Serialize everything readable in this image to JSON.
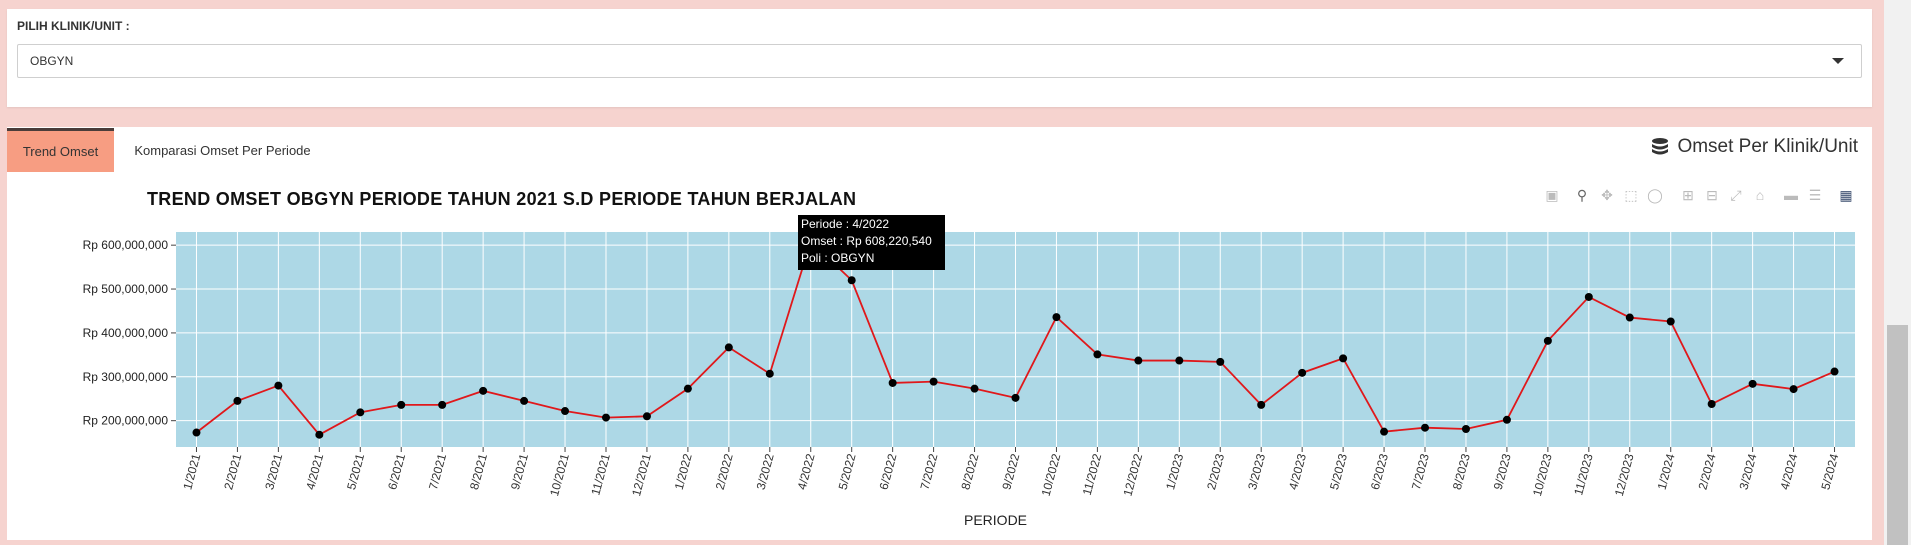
{
  "filter": {
    "label": "PILIH KLINIK/UNIT :",
    "selected": "OBGYN"
  },
  "tabs": [
    {
      "label": "Trend Omset",
      "active": true
    },
    {
      "label": "Komparasi Omset Per Periode",
      "active": false
    }
  ],
  "panel": {
    "title": "Omset Per Klinik/Unit",
    "icon": "coins-icon"
  },
  "modebar_icons": [
    "camera-icon",
    "zoom-icon",
    "pan-icon",
    "box-select-icon",
    "lasso-icon",
    "zoom-in-icon",
    "zoom-out-icon",
    "autoscale-icon",
    "reset-axes-icon",
    "spike-lines-icon",
    "compare-hover-icon",
    "plotly-logo-icon"
  ],
  "tooltip": {
    "line1": "Periode : 4/2022",
    "line2": "Omset : Rp 608,220,540",
    "line3": "Poli : OBGYN"
  },
  "chart_data": {
    "type": "line",
    "title": "TREND OMSET OBGYN PERIODE TAHUN 2021 S.D PERIODE TAHUN BERJALAN",
    "xlabel": "PERIODE",
    "ylabel": "",
    "categories": [
      "1/2021",
      "2/2021",
      "3/2021",
      "4/2021",
      "5/2021",
      "6/2021",
      "7/2021",
      "8/2021",
      "9/2021",
      "10/2021",
      "11/2021",
      "12/2021",
      "1/2022",
      "2/2022",
      "3/2022",
      "4/2022",
      "5/2022",
      "6/2022",
      "7/2022",
      "8/2022",
      "9/2022",
      "10/2022",
      "11/2022",
      "12/2022",
      "1/2023",
      "2/2023",
      "3/2023",
      "4/2023",
      "5/2023",
      "6/2023",
      "7/2023",
      "8/2023",
      "9/2023",
      "10/2023",
      "11/2023",
      "12/2023",
      "1/2024",
      "2/2024",
      "3/2024",
      "4/2024",
      "5/2024"
    ],
    "series": [
      {
        "name": "OBGYN",
        "values": [
          173000000,
          245000000,
          280000000,
          168000000,
          219000000,
          236000000,
          236000000,
          268000000,
          245000000,
          222000000,
          207000000,
          210000000,
          273000000,
          367000000,
          307000000,
          608220540,
          520000000,
          286000000,
          289000000,
          273000000,
          252000000,
          436000000,
          351000000,
          337000000,
          337000000,
          334000000,
          236000000,
          309000000,
          342000000,
          175000000,
          184000000,
          181000000,
          202000000,
          382000000,
          482000000,
          435000000,
          426000000,
          238000000,
          284000000,
          272000000,
          312000000
        ]
      }
    ],
    "ylim": [
      140000000,
      630000000
    ],
    "yticks": [
      200000000,
      300000000,
      400000000,
      500000000,
      600000000
    ],
    "yticklabels": [
      "Rp 200,000,000",
      "Rp 300,000,000",
      "Rp 400,000,000",
      "Rp 500,000,000",
      "Rp 600,000,000"
    ],
    "line_color": "#e0181b",
    "marker_color": "#000000",
    "plot_bg": "#add8e6",
    "grid": true
  }
}
